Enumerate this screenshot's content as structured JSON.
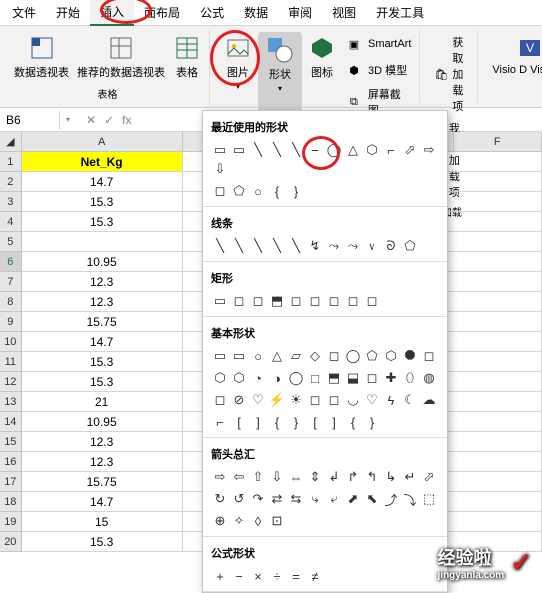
{
  "tabs": [
    "文件",
    "开始",
    "插入",
    "面布局",
    "公式",
    "数据",
    "审阅",
    "视图",
    "开发工具"
  ],
  "active_tab_index": 2,
  "ribbon": {
    "pivot_table": "数据透视表",
    "recommended_pivot": "推荐的数据透视表",
    "table": "表格",
    "group_table": "表格",
    "picture": "图片",
    "shapes": "形状",
    "icon": "图标",
    "smartart": "SmartArt",
    "model3d": "3D 模型",
    "screenshot": "屏幕截图",
    "addins_get": "获取加载项",
    "addins_my": "我的加载项",
    "visio": "Visio D Visualiz",
    "group_addins": "加载"
  },
  "name_box": "B6",
  "columns": [
    "A",
    "F"
  ],
  "header_cell": "Net_Kg",
  "data": [
    "14.7",
    "15.3",
    "15.3",
    "",
    "10.95",
    "12.3",
    "12.3",
    "15.75",
    "14.7",
    "15.3",
    "15.3",
    "21",
    "10.95",
    "12.3",
    "12.3",
    "15.75",
    "14.7",
    "15",
    "15.3"
  ],
  "shapes_panel": {
    "recent": "最近使用的形状",
    "lines": "线条",
    "rects": "矩形",
    "basic": "基本形状",
    "arrows": "箭头总汇",
    "formula": "公式形状"
  },
  "shape_glyphs": {
    "recent1": [
      "▭",
      "▭",
      "╲",
      "╲",
      "╲",
      "⎯",
      "◯",
      "△",
      "⬡",
      "⌐",
      "⬀",
      "⇨",
      "⇩"
    ],
    "recent2": [
      "◻",
      "⬠",
      "○",
      "{",
      "}"
    ],
    "lines": [
      "╲",
      "╲",
      "╲",
      "╲",
      "╲",
      "↯",
      "⤳",
      "⤳",
      "᥎",
      "ᘐ",
      "⬠"
    ],
    "rects": [
      "▭",
      "◻",
      "◻",
      "⬒",
      "◻",
      "◻",
      "◻",
      "◻",
      "◻"
    ],
    "basic1": [
      "▭",
      "▭",
      "○",
      "△",
      "▱",
      "◇",
      "◻",
      "◯",
      "⬠",
      "⬡",
      "⯃",
      "◻"
    ],
    "basic2": [
      "⬡",
      "⬡",
      "◔",
      "◑",
      "◯",
      "□",
      "⬒",
      "⬓",
      "◻",
      "✚",
      "⬯",
      "◍"
    ],
    "basic3": [
      "◻",
      "⊘",
      "♡",
      "⚡",
      "☀",
      "◻",
      "◻",
      "◡",
      "♡",
      "ϟ",
      "☾",
      "☁"
    ],
    "basic4": [
      "⌐",
      "[",
      "]",
      "{",
      "}",
      "[",
      "]",
      "{",
      "}"
    ],
    "arrows1": [
      "⇨",
      "⇦",
      "⇧",
      "⇩",
      "⇔",
      "⇕",
      "↲",
      "↱",
      "↰",
      "↳",
      "↵",
      "⬀"
    ],
    "arrows2": [
      "↻",
      "↺",
      "↷",
      "⇄",
      "⇆",
      "⤷",
      "⤶",
      "⬈",
      "⬉",
      "⤴",
      "⤵",
      "⬚"
    ],
    "arrows3": [
      "⊕",
      "✧",
      "◊",
      "⊡"
    ],
    "formula": [
      "+",
      "−",
      "×",
      "÷",
      "=",
      "≠"
    ]
  },
  "watermark": {
    "main": "经验啦",
    "sub": "jingyanla.com"
  }
}
